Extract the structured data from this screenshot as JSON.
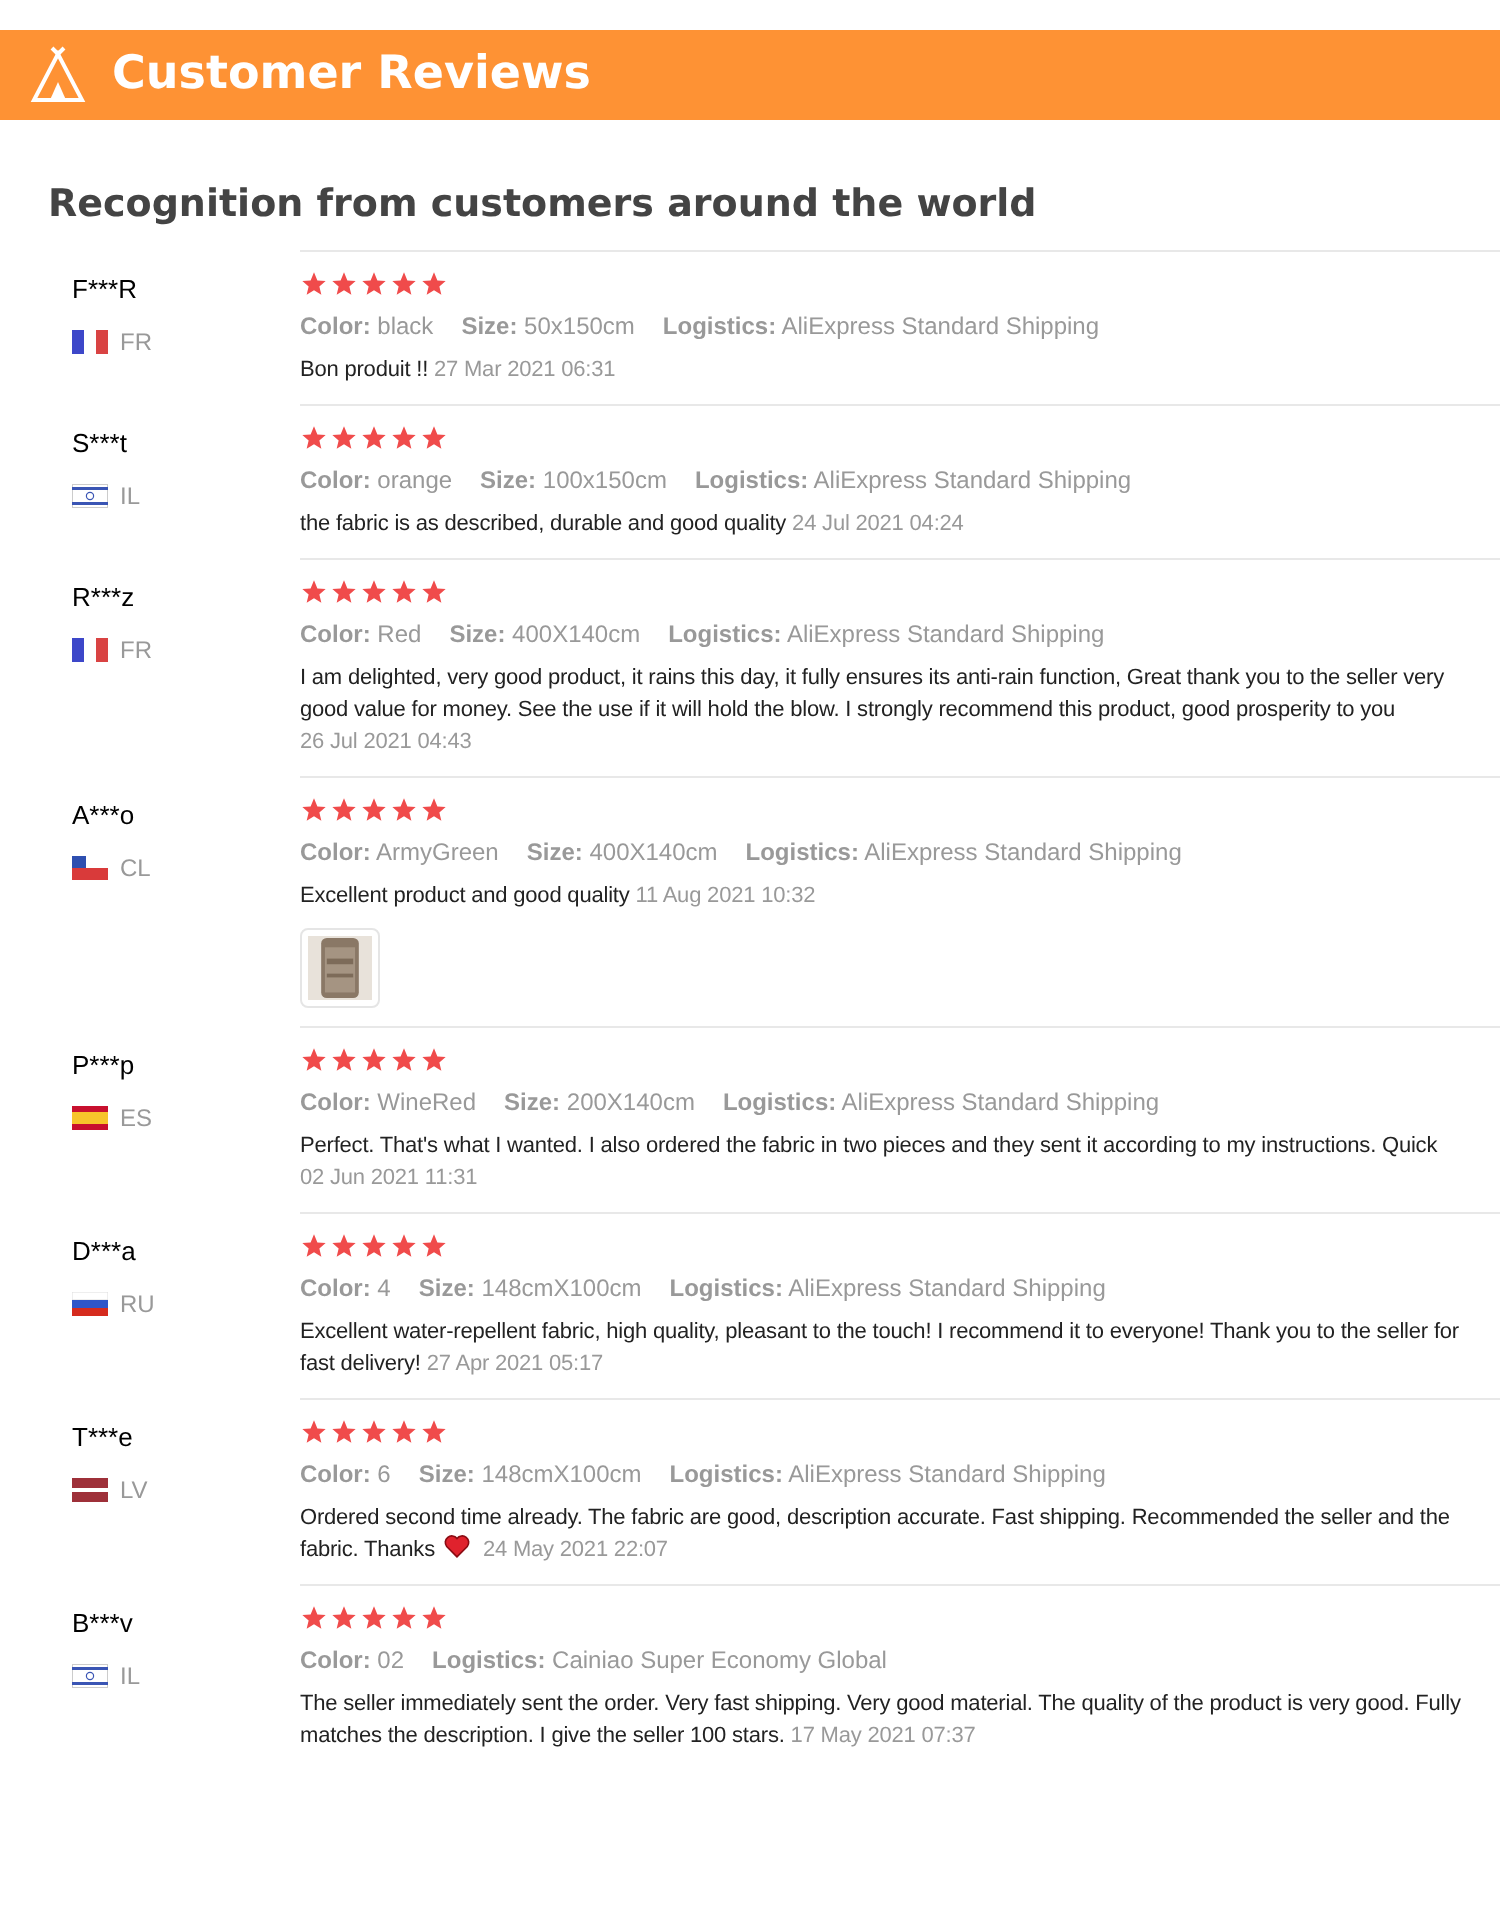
{
  "banner": {
    "title": "Customer Reviews"
  },
  "heading": "Recognition from customers around the world",
  "reviews": [
    {
      "name": "F***R",
      "country": "FR",
      "kind": "fr",
      "stars": 5,
      "attributes": [
        {
          "label": "Color:",
          "value": "black"
        },
        {
          "label": "Size:",
          "value": "50x150cm"
        },
        {
          "label": "Logistics:",
          "value": "AliExpress Standard Shipping"
        }
      ],
      "text": "Bon produit !!",
      "heart": false,
      "date": "27 Mar 2021 06:31"
    },
    {
      "name": "S***t",
      "country": "IL",
      "kind": "il",
      "stars": 5,
      "attributes": [
        {
          "label": "Color:",
          "value": "orange"
        },
        {
          "label": "Size:",
          "value": "100x150cm"
        },
        {
          "label": "Logistics:",
          "value": "AliExpress Standard Shipping"
        }
      ],
      "text": "the fabric is as described, durable and good quality",
      "heart": false,
      "date": "24 Jul 2021 04:24"
    },
    {
      "name": "R***z",
      "country": "FR",
      "kind": "fr",
      "stars": 5,
      "attributes": [
        {
          "label": "Color:",
          "value": "Red"
        },
        {
          "label": "Size:",
          "value": "400X140cm"
        },
        {
          "label": "Logistics:",
          "value": "AliExpress Standard Shipping"
        }
      ],
      "text": "I am delighted, very good product, it rains this day, it fully ensures its anti-rain function, Great thank you to the seller very good value for money. See the use if it will hold the blow. I strongly recommend this product, good prosperity to you",
      "heart": false,
      "date": "26 Jul 2021 04:43"
    },
    {
      "name": "A***o",
      "country": "CL",
      "kind": "cl",
      "stars": 5,
      "attributes": [
        {
          "label": "Color:",
          "value": "ArmyGreen"
        },
        {
          "label": "Size:",
          "value": "400X140cm"
        },
        {
          "label": "Logistics:",
          "value": "AliExpress Standard Shipping"
        }
      ],
      "text": "Excellent product and good quality",
      "heart": false,
      "date": "11 Aug 2021 10:32",
      "photos": [
        {
          "kind": "picture"
        }
      ]
    },
    {
      "name": "P***p",
      "country": "ES",
      "kind": "es",
      "stars": 5,
      "attributes": [
        {
          "label": "Color:",
          "value": "WineRed"
        },
        {
          "label": "Size:",
          "value": "200X140cm"
        },
        {
          "label": "Logistics:",
          "value": "AliExpress Standard Shipping"
        }
      ],
      "text": "Perfect. That's what I wanted. I also ordered the fabric in two pieces and they sent it according to my instructions. Quick",
      "heart": false,
      "date": "02 Jun 2021 11:31"
    },
    {
      "name": "D***a",
      "country": "RU",
      "kind": "ru",
      "stars": 5,
      "attributes": [
        {
          "label": "Color:",
          "value": "4"
        },
        {
          "label": "Size:",
          "value": "148cmX100cm"
        },
        {
          "label": "Logistics:",
          "value": "AliExpress Standard Shipping"
        }
      ],
      "text": "Excellent water-repellent fabric, high quality, pleasant to the touch! I recommend it to everyone! Thank you to the seller for fast delivery!",
      "heart": false,
      "date": "27 Apr 2021 05:17"
    },
    {
      "name": "T***e",
      "country": "LV",
      "kind": "lv",
      "stars": 5,
      "attributes": [
        {
          "label": "Color:",
          "value": "6"
        },
        {
          "label": "Size:",
          "value": "148cmX100cm"
        },
        {
          "label": "Logistics:",
          "value": "AliExpress Standard Shipping"
        }
      ],
      "text": "Ordered second time already. The fabric are good, description accurate. Fast shipping. Recommended the seller and the fabric. Thanks",
      "heart": true,
      "date": "24 May 2021 22:07"
    },
    {
      "name": "B***v",
      "country": "IL",
      "kind": "il",
      "stars": 5,
      "attributes": [
        {
          "label": "Color:",
          "value": "02"
        },
        {
          "label": "Logistics:",
          "value": "Cainiao Super Economy Global"
        }
      ],
      "text": "The seller immediately sent the order. Very fast shipping. Very good material. The quality of the product is very good. Fully matches the description. I give the seller 100 stars.",
      "heart": false,
      "date": "17 May 2021 07:37"
    }
  ]
}
